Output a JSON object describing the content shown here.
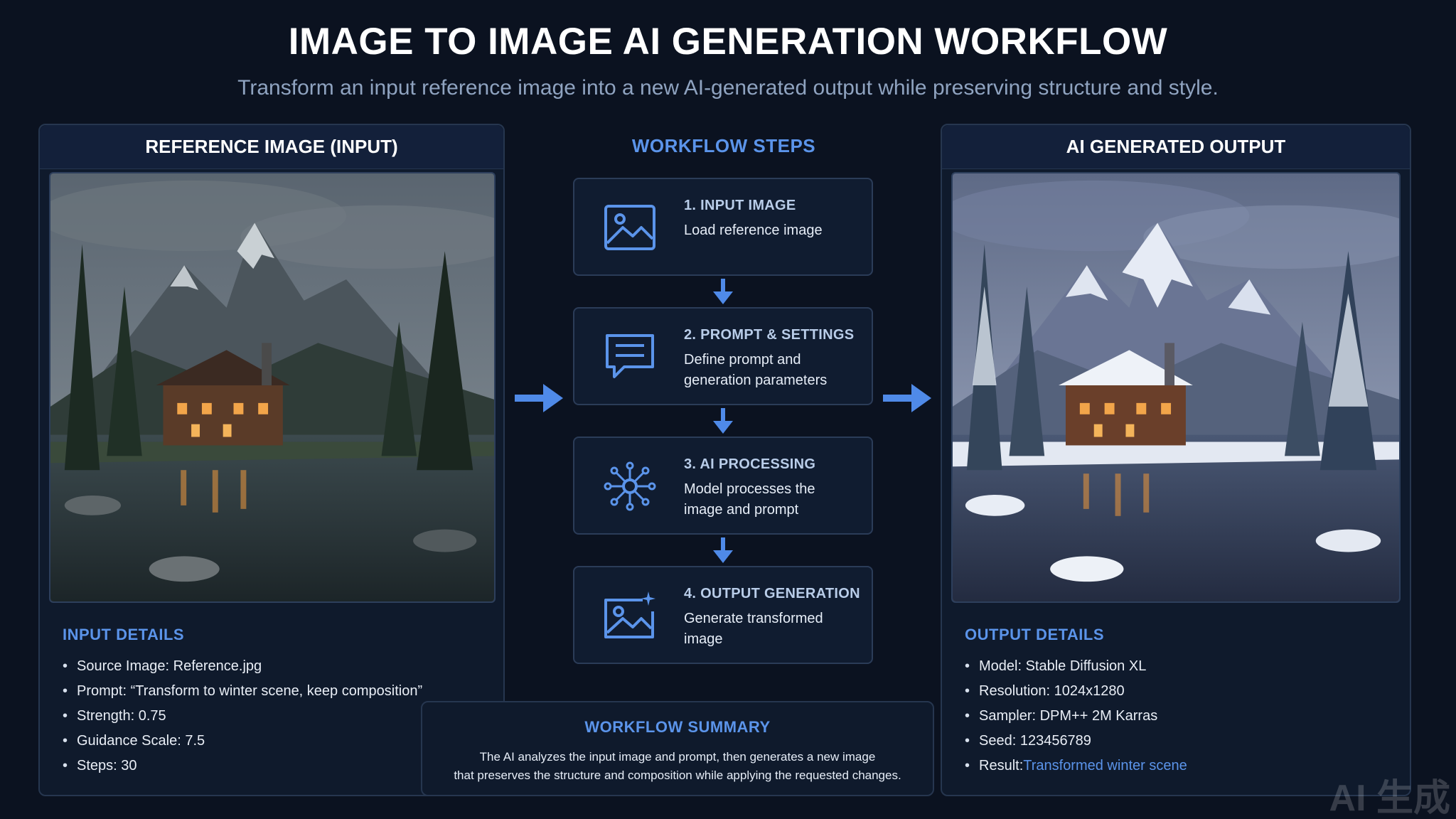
{
  "header": {
    "title": "IMAGE TO IMAGE AI GENERATION WORKFLOW",
    "subtitle": "Transform an input reference image into a new AI-generated output while preserving structure and style."
  },
  "input_panel": {
    "heading": "REFERENCE IMAGE (INPUT)",
    "details_title": "INPUT DETAILS",
    "details": [
      "Source Image: Reference.jpg",
      "Prompt: “Transform to winter scene, keep composition”",
      "Strength: 0.75",
      "Guidance Scale: 7.5",
      "Steps: 30"
    ]
  },
  "workflow": {
    "heading": "WORKFLOW STEPS",
    "steps": [
      {
        "title": "1. INPUT IMAGE",
        "desc": "Load reference image",
        "icon": "image-icon"
      },
      {
        "title": "2. PROMPT & SETTINGS",
        "desc": "Define prompt and generation parameters",
        "icon": "chat-icon"
      },
      {
        "title": "3. AI PROCESSING",
        "desc": "Model processes the image and prompt",
        "icon": "neural-network-icon"
      },
      {
        "title": "4. OUTPUT GENERATION",
        "desc": "Generate transformed image",
        "icon": "image-sparkle-icon"
      }
    ]
  },
  "output_panel": {
    "heading": "AI GENERATED OUTPUT",
    "details_title": "OUTPUT DETAILS",
    "details": [
      "Model: Stable Diffusion XL",
      "Resolution: 1024x1280",
      "Sampler: DPM++ 2M Karras",
      "Seed: 123456789"
    ],
    "result_label": "Result: ",
    "result_value": "Transformed winter scene"
  },
  "summary": {
    "title": "WORKFLOW SUMMARY",
    "line1": "The AI analyzes the input image and prompt, then generates a new image",
    "line2": "that preserves the structure and composition while applying the requested changes."
  },
  "watermark": "AI 生成",
  "colors": {
    "background": "#0b1220",
    "accent": "#5b94ea",
    "panel": "#0f1a2c",
    "border": "#26364f"
  }
}
